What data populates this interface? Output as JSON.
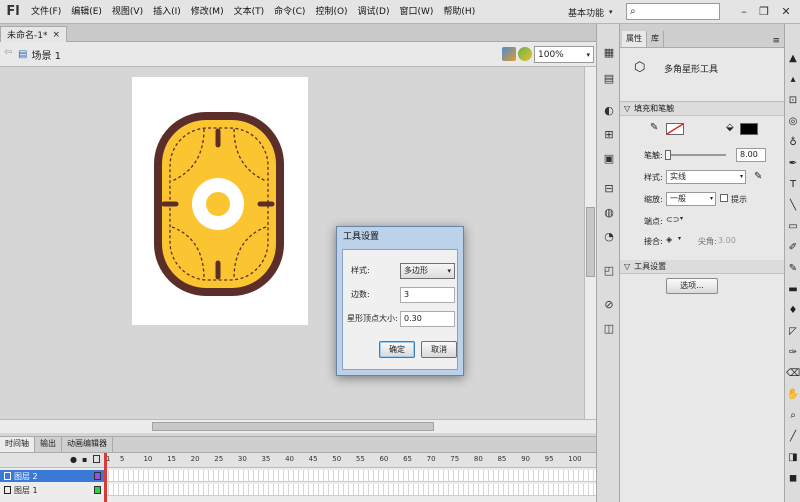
{
  "app": {
    "logo": "Fl"
  },
  "menu": [
    "文件(F)",
    "编辑(E)",
    "视图(V)",
    "插入(I)",
    "修改(M)",
    "文本(T)",
    "命令(C)",
    "控制(O)",
    "调试(D)",
    "窗口(W)",
    "帮助(H)"
  ],
  "workspace": {
    "label": "基本功能",
    "caret": "▾"
  },
  "search": {
    "icon": "⌕"
  },
  "window_controls": {
    "minimize": "–",
    "restore": "❐",
    "close": "✕"
  },
  "document": {
    "tab_title": "未命名-1*",
    "close_glyph": "×"
  },
  "editbar": {
    "back_glyph": "⇦",
    "scene_icon": "▤",
    "scene_label": "场景 1",
    "zoom": "100%",
    "zoom_caret": "▾"
  },
  "dialog": {
    "title": "工具设置",
    "style_label": "样式:",
    "style_value": "多边形",
    "sides_label": "边数:",
    "sides_value": "3",
    "star_label": "星形顶点大小:",
    "star_value": "0.30",
    "ok_label": "确定",
    "cancel_label": "取消",
    "caret": "▾"
  },
  "timeline": {
    "tabs": [
      "时间轴",
      "输出",
      "动画编辑器"
    ],
    "frame_numbers": [
      "1",
      "5",
      "10",
      "15",
      "20",
      "25",
      "30",
      "35",
      "40",
      "45",
      "50",
      "55",
      "60",
      "65",
      "70",
      "75",
      "80",
      "85",
      "90",
      "95",
      "100"
    ],
    "layers": [
      {
        "name": "图层 2",
        "bg": "#3b79d6",
        "color": "#ffffff",
        "swatch": "#9e4fe0"
      },
      {
        "name": "图层 1",
        "bg": "#ececec",
        "color": "#222222",
        "swatch": "#2fcf4d"
      }
    ]
  },
  "properties": {
    "tabs": [
      "属性",
      "库"
    ],
    "menu_glyph": "≡",
    "tool_icon": "⬡",
    "tool_name": "多角星形工具",
    "fill_stroke_header": "填充和笔触",
    "stroke_label": "笔触:",
    "stroke_value": "8.00",
    "style_label": "样式:",
    "style_value": "实线",
    "scale_label": "缩放:",
    "scale_value": "一般",
    "hint_label": "提示",
    "cap_label": "端点:",
    "join_label": "接合:",
    "miter_label": "尖角:",
    "miter_value": "3.00",
    "tool_settings_header": "工具设置",
    "options_button": "选项...",
    "stroke_color": "#ffffff",
    "fill_color": "#000000",
    "pencil_glyph": "✎",
    "bucket_glyph": "⬙",
    "caret": "▾",
    "collapse_glyph": "▽",
    "cap_glyph": "⊂⊃",
    "join_glyph": "◈"
  },
  "dock_icons": [
    "▦",
    "▤",
    "◐",
    "⊞",
    "▣",
    "⊟",
    "◍",
    "◔",
    "◰",
    "⊘",
    "◫"
  ],
  "tools": [
    "▲",
    "▴",
    "⊡",
    "◎",
    "♁",
    "✒",
    "T",
    "╲",
    "▭",
    "✐",
    "✎",
    "▬",
    "♦",
    "◸",
    "✑",
    "⌫",
    "✋",
    "⌕",
    "╱",
    "◨",
    "◼"
  ],
  "artwork": {
    "outline_color": "#5c2e2a",
    "fill_color": "#fbc531",
    "ring_color": "#ffffff"
  }
}
